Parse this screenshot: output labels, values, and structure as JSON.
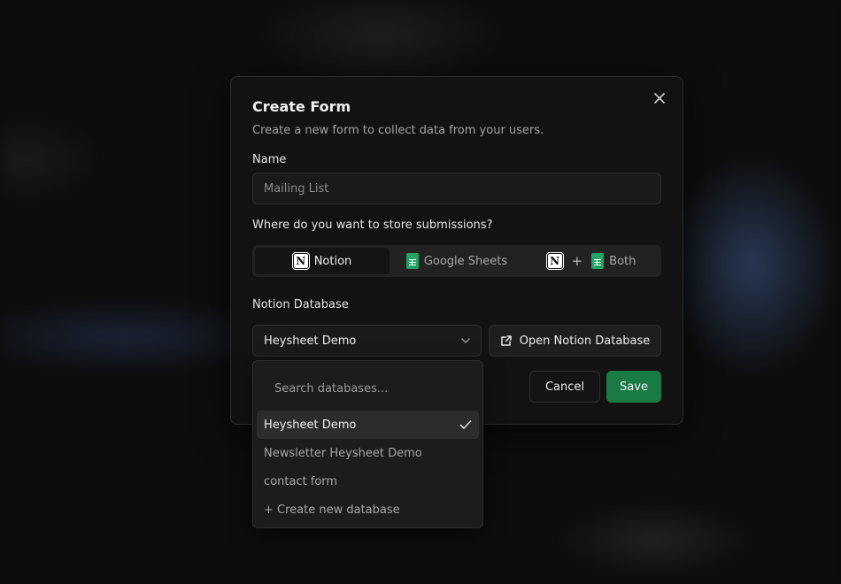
{
  "modal": {
    "title": "Create Form",
    "subtitle": "Create a new form to collect data from your users.",
    "name_label": "Name",
    "name_placeholder": "Mailing List",
    "storage_label": "Where do you want to store submissions?",
    "storage_options": [
      {
        "label": "Notion",
        "icon": "notion-icon",
        "active": true
      },
      {
        "label": "Google Sheets",
        "icon": "google-sheets-icon",
        "active": false
      },
      {
        "label": "Both",
        "icon": "notion-plus-sheets-icon",
        "active": false
      }
    ],
    "plus_sign": "+",
    "database_label": "Notion Database",
    "database_selected": "Heysheet Demo",
    "open_button": "Open Notion Database",
    "cancel_button": "Cancel",
    "save_button": "Save"
  },
  "dropdown": {
    "search_placeholder": "Search databases...",
    "items": [
      {
        "label": "Heysheet Demo",
        "selected": true
      },
      {
        "label": "Newsletter Heysheet Demo",
        "selected": false
      },
      {
        "label": "contact form",
        "selected": false
      },
      {
        "label": "+ Create new database",
        "selected": false
      }
    ]
  },
  "colors": {
    "accent_save": "#1a7a45",
    "sheets_green": "#21a366"
  }
}
